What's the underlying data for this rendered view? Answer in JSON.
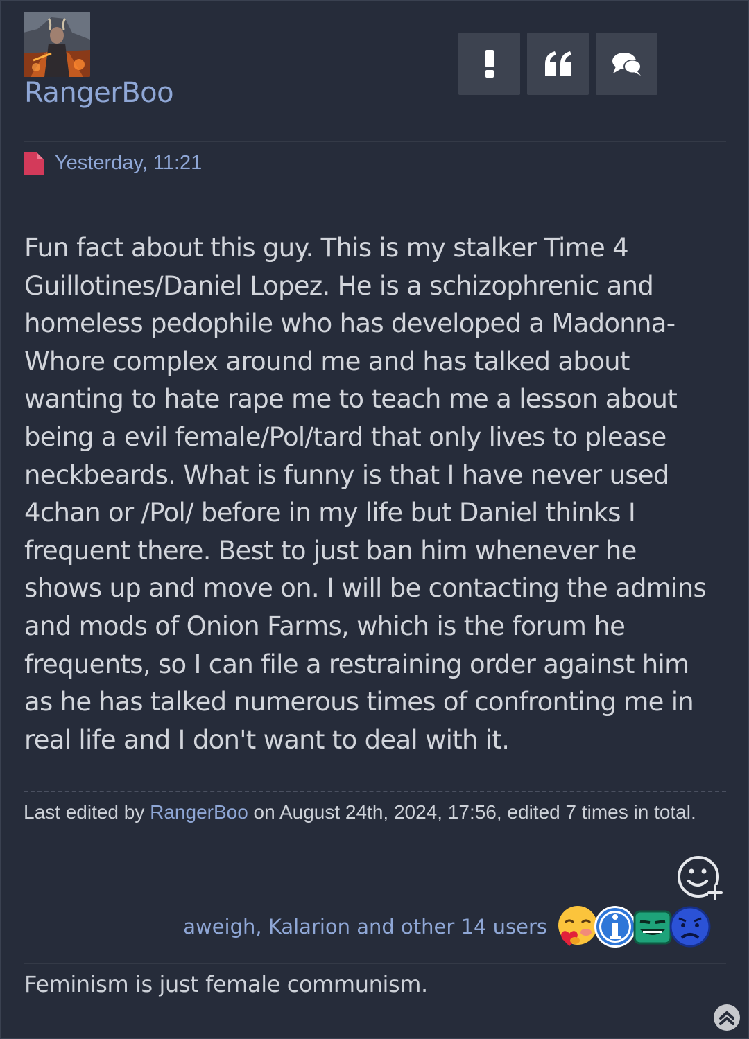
{
  "post": {
    "author": "RangerBoo",
    "avatar_alt": "RangerBoo avatar",
    "timestamp": "Yesterday, 11:21",
    "content": "Fun fact about this guy. This is my stalker Time 4 Guillotines/Daniel Lopez. He is a schizophrenic and homeless pedophile who has developed a Madonna-Whore complex around me and has talked about wanting to hate rape me to teach me a lesson about being a evil female/Pol/tard that only lives to please neckbeards. What is funny is that I have never used 4chan or /Pol/ before in my life but Daniel thinks I frequent there. Best to just ban him whenever he shows up and move on. I will be contacting the admins and mods of Onion Farms, which is the forum he frequents, so I can file a restraining order against him as he has talked numerous times of confronting me in real life and I don't want to deal with it.",
    "edit": {
      "prefix": "Last edited by ",
      "user": "RangerBoo",
      "suffix": " on August 24th, 2024, 17:56, edited 7 times in total."
    },
    "reactions": {
      "text": "aweigh, Kalarion and other 14 users",
      "emojis": [
        "heart-hug-emoji",
        "info-emoji",
        "grin-emoji",
        "worried-emoji"
      ]
    },
    "signature": "Feminism is just female communism."
  },
  "actions": {
    "report": "report-icon",
    "quote": "quote-icon",
    "reply": "reply-icon"
  },
  "colors": {
    "background": "#262c3a",
    "link": "#8fa7d6",
    "button": "#3d4350",
    "text": "#d2d5db",
    "post_icon": "#d33a5a"
  }
}
